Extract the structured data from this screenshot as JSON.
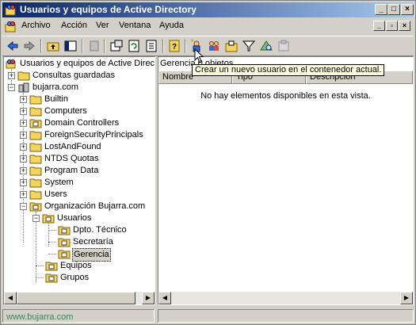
{
  "window": {
    "title": "Usuarios y equipos de Active Directory",
    "caption_buttons": [
      "_",
      "□",
      "×"
    ],
    "mdi_buttons": [
      "_",
      "▫",
      "×"
    ]
  },
  "menu": {
    "items": [
      {
        "label": "Archivo"
      },
      {
        "label": "Acción"
      },
      {
        "label": "Ver"
      },
      {
        "label": "Ventana"
      },
      {
        "label": "Ayuda"
      }
    ]
  },
  "toolbar": {
    "buttons": [
      {
        "icon": "back-arrow-icon"
      },
      {
        "icon": "forward-arrow-icon"
      },
      {
        "icon": "up-folder-icon"
      },
      {
        "icon": "show-tree-icon"
      },
      {
        "icon": "delete-icon"
      },
      {
        "icon": "properties-icon"
      },
      {
        "icon": "refresh-icon"
      },
      {
        "icon": "export-list-icon"
      },
      {
        "icon": "help-icon"
      },
      {
        "icon": "new-user-icon"
      },
      {
        "icon": "new-group-icon"
      },
      {
        "icon": "new-ou-icon"
      },
      {
        "icon": "filter-icon"
      },
      {
        "icon": "find-icon"
      },
      {
        "icon": "add-to-group-icon"
      }
    ]
  },
  "tooltip": "Crear un nuevo usuario en el contenedor  actual.",
  "tree": {
    "root": "Usuarios y equipos de Active Director",
    "items": [
      {
        "label": "Consultas guardadas"
      },
      {
        "label": "bujarra.com"
      },
      {
        "label": "Builtin"
      },
      {
        "label": "Computers"
      },
      {
        "label": "Domain Controllers"
      },
      {
        "label": "ForeignSecurityPrincipals"
      },
      {
        "label": "LostAndFound"
      },
      {
        "label": "NTDS Quotas"
      },
      {
        "label": "Program Data"
      },
      {
        "label": "System"
      },
      {
        "label": "Users"
      },
      {
        "label": "Organización Bujarra.com"
      },
      {
        "label": "Usuarios"
      },
      {
        "label": "Dpto. Técnico"
      },
      {
        "label": "Secretaría"
      },
      {
        "label": "Gerencia"
      },
      {
        "label": "Equipos"
      },
      {
        "label": "Grupos"
      }
    ]
  },
  "list": {
    "path": "Gerencia   0 objetos",
    "columns": [
      "Nombre",
      "Tipo",
      "Descripción"
    ],
    "empty_message": "No hay elementos disponibles en esta vista."
  },
  "status": {
    "text": "www.bujarra.com"
  },
  "colors": {
    "titlebar_start": "#0a246a",
    "titlebar_end": "#a6caf0",
    "folder": "#f4d35e",
    "status_text": "#2e8b57"
  }
}
